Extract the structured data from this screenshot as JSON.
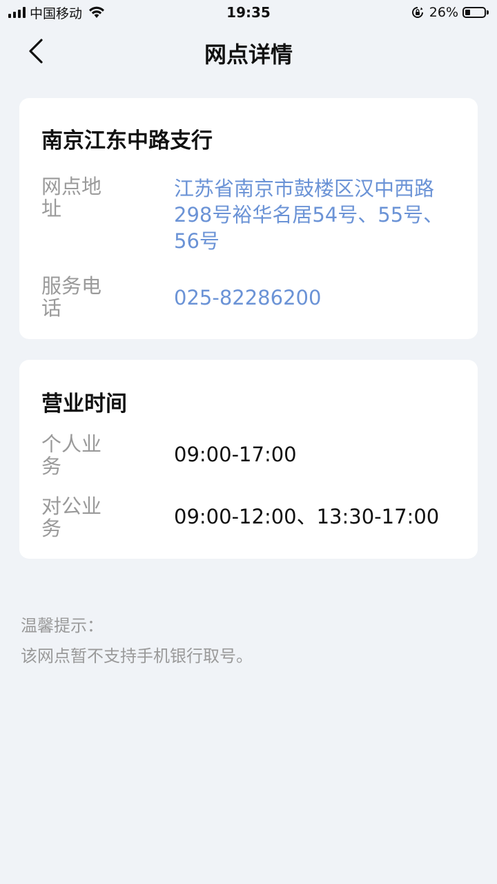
{
  "status_bar": {
    "carrier": "中国移动",
    "time": "19:35",
    "battery_percent": "26%",
    "battery_level": 0.26,
    "icons": [
      "signal-icon",
      "wifi-icon",
      "rotation-lock-icon",
      "battery-icon"
    ]
  },
  "nav": {
    "title": "网点详情",
    "back_icon": "chevron-left-icon"
  },
  "branch": {
    "name": "南京江东中路支行",
    "address_label": "网点地址",
    "address": "江苏省南京市鼓楼区汉中西路298号裕华名居54号、55号、56号",
    "phone_label": "服务电话",
    "phone": "025-82286200"
  },
  "hours": {
    "title": "营业时间",
    "personal_label": "个人业务",
    "personal_value": "09:00-17:00",
    "corporate_label": "对公业务",
    "corporate_value": "09:00-12:00、13:30-17:00"
  },
  "tips": {
    "title": "温馨提示：",
    "text": "该网点暂不支持手机银行取号。"
  },
  "colors": {
    "background": "#f0f3f7",
    "card": "#ffffff",
    "link": "#6b93d6",
    "label": "#9a9a9a",
    "text": "#111111"
  }
}
